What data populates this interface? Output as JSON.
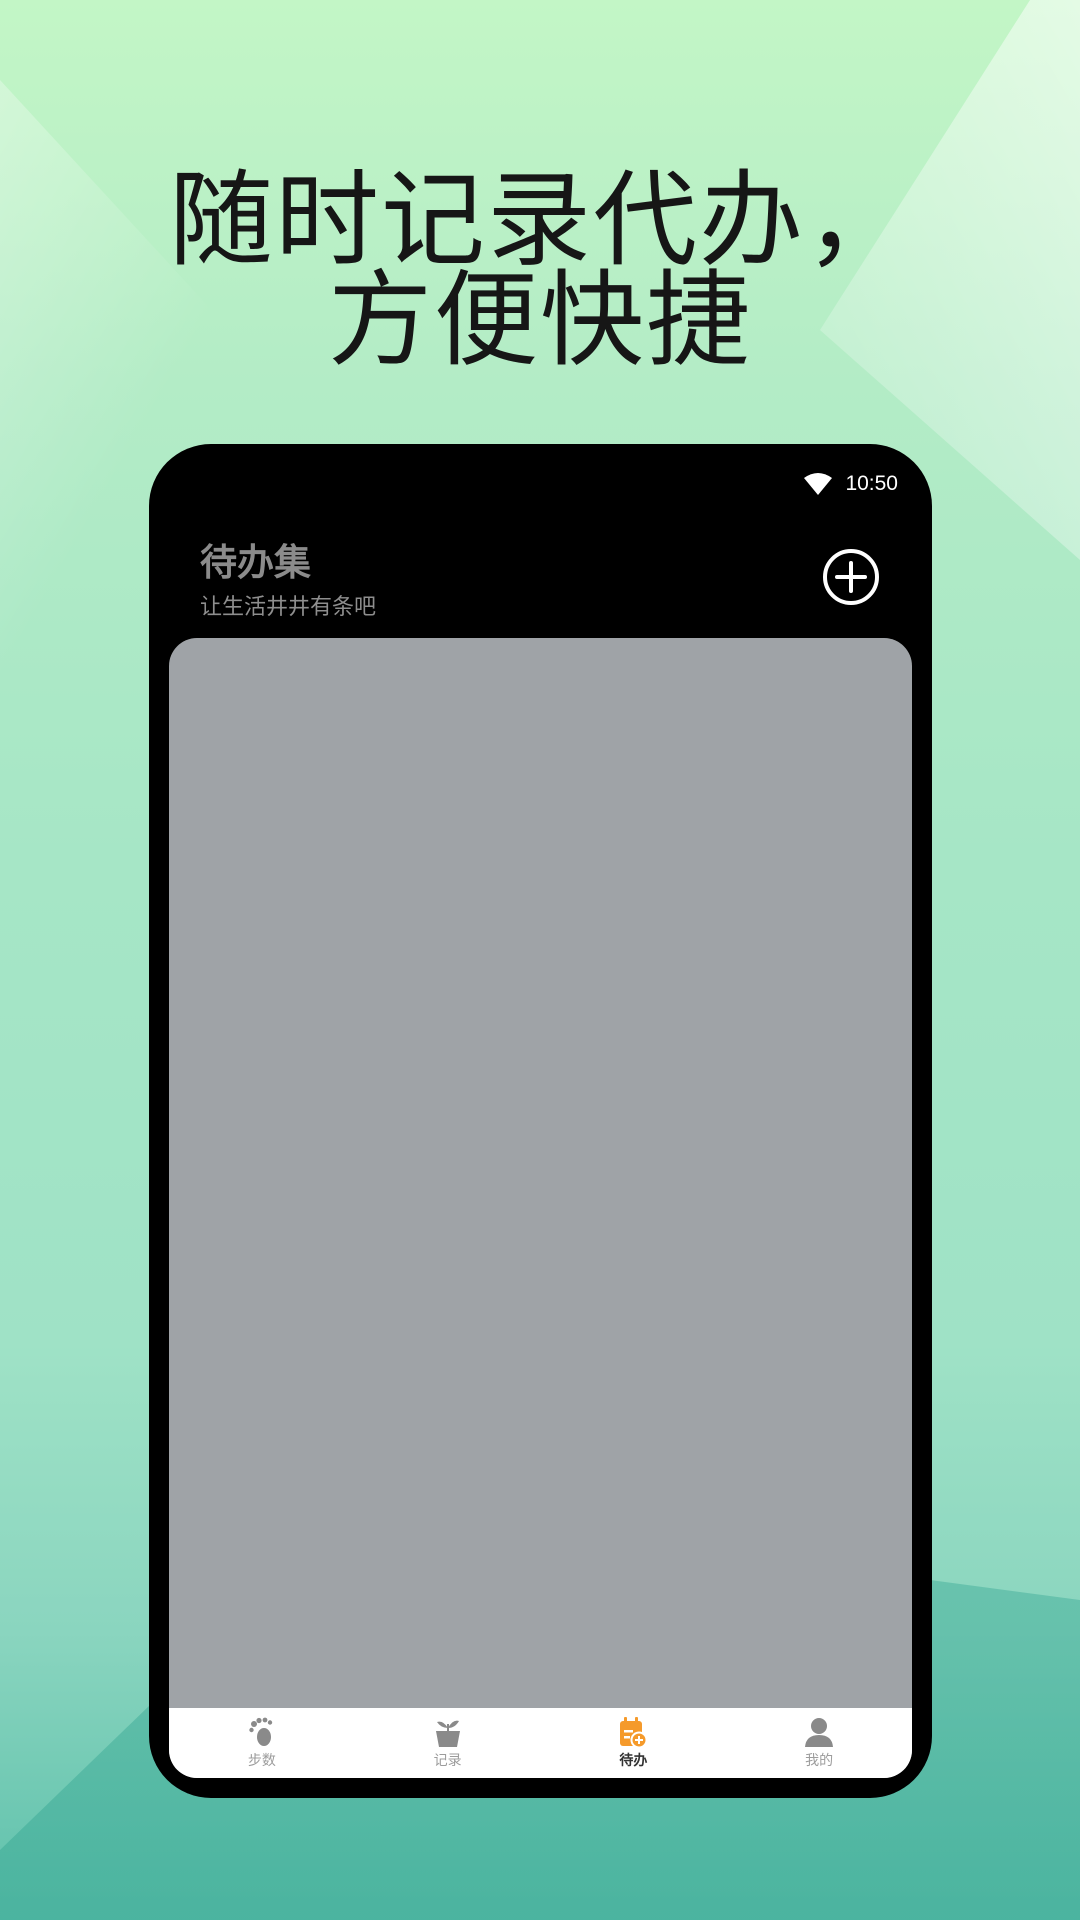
{
  "headline": {
    "line1": "随时记录代办，",
    "line2": "方便快捷"
  },
  "status_bar": {
    "time": "10:50",
    "icons": [
      "wifi-icon"
    ]
  },
  "app_header": {
    "title": "待办集",
    "subtitle": "让生活井井有条吧",
    "add_icon": "plus-circle-icon"
  },
  "tabbar": {
    "items": [
      {
        "label": "步数",
        "icon": "footprint-icon",
        "active": false
      },
      {
        "label": "记录",
        "icon": "plant-pot-icon",
        "active": false
      },
      {
        "label": "待办",
        "icon": "calendar-add-icon",
        "active": true
      },
      {
        "label": "我的",
        "icon": "user-icon",
        "active": false
      }
    ]
  },
  "colors": {
    "phone_bg": "#000000",
    "card_gray": "#9fa3a7",
    "accent_orange": "#f59a2b",
    "inactive_icon": "#8a8a8a"
  }
}
